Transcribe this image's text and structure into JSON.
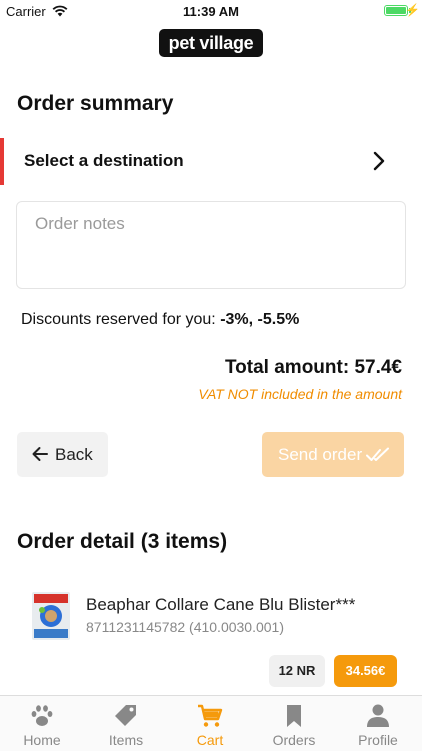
{
  "status_bar": {
    "carrier": "Carrier",
    "time": "11:39 AM"
  },
  "header": {
    "logo_text": "pet village"
  },
  "summary": {
    "title": "Order summary",
    "destination_label": "Select a destination",
    "notes_placeholder": "Order notes",
    "discounts_prefix": "Discounts reserved for you: ",
    "discounts_values": "-3%, -5.5%",
    "total": "Total amount: 57.4€",
    "vat_note": "VAT NOT included in the amount"
  },
  "actions": {
    "back_label": "Back",
    "send_label": "Send order"
  },
  "detail": {
    "title": "Order detail (3 items)",
    "items": [
      {
        "name": "Beaphar Collare Cane Blu Blister***",
        "code": "8711231145782 (410.0030.001)",
        "qty": "12 NR",
        "price": "34.56€"
      }
    ]
  },
  "tabs": [
    {
      "label": "Home",
      "icon": "paw-icon"
    },
    {
      "label": "Items",
      "icon": "tag-icon"
    },
    {
      "label": "Cart",
      "icon": "cart-icon",
      "active": true
    },
    {
      "label": "Orders",
      "icon": "bookmark-icon"
    },
    {
      "label": "Profile",
      "icon": "person-icon"
    }
  ],
  "colors": {
    "accent": "#f59a0c",
    "send_disabled": "#fad5a3",
    "destination_marker": "#e53935",
    "vat_text": "#f08c00"
  }
}
